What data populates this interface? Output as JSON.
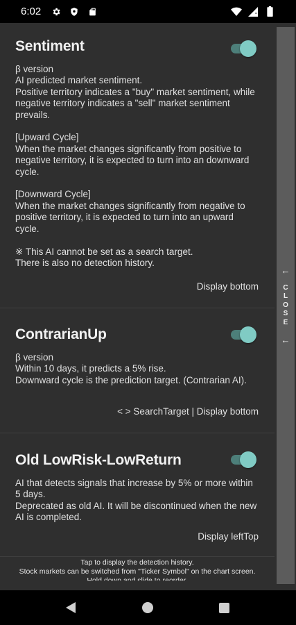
{
  "status_bar": {
    "time": "6:02",
    "left_icons": [
      "gear-icon",
      "shield-icon",
      "sd-card-icon"
    ],
    "right_icons": [
      "wifi-icon",
      "signal-icon",
      "battery-icon"
    ]
  },
  "cards": [
    {
      "title": "Sentiment",
      "enabled": true,
      "body": "β version\nAI predicted market sentiment.\nPositive territory indicates a \"buy\" market sentiment, while negative territory indicates a \"sell\" market sentiment prevails.\n\n[Upward Cycle]\nWhen the market changes significantly from positive to negative territory, it is expected to turn into an downward cycle.\n\n[Downward Cycle]\nWhen the market changes significantly from negative to positive territory, it is expected to turn into an upward cycle.\n\n※ This AI cannot be set as a search target.\nThere is also no detection history.",
      "footer": "Display bottom"
    },
    {
      "title": "ContrarianUp",
      "enabled": true,
      "body": "β version\nWithin 10 days, it predicts a 5% rise.\nDownward cycle is the prediction target. (Contrarian AI).",
      "footer": "< > SearchTarget | Display bottom"
    },
    {
      "title": "Old LowRisk-LowReturn",
      "enabled": true,
      "body": "AI that detects signals that increase by 5% or more within 5 days.\nDeprecated as old AI. It will be discontinued when the new AI is completed.",
      "footer": "Display leftTop"
    }
  ],
  "close_tab": {
    "arrow_top": "←",
    "letters": [
      "C",
      "L",
      "O",
      "S",
      "E"
    ],
    "arrow_bottom": "←"
  },
  "footer_note": "Tap to display the detection history.\nStock markets can be switched from \"Ticker Symbol\" on the chart screen.\nHold down and slide to reorder.",
  "nav_bar": {
    "buttons": [
      "back-icon",
      "home-icon",
      "recents-icon"
    ]
  },
  "colors": {
    "background": "#2f2f2f",
    "toggle_thumb": "#80cbc4",
    "toggle_track": "#4d7f7a",
    "close_tab": "#5c5c5c"
  }
}
